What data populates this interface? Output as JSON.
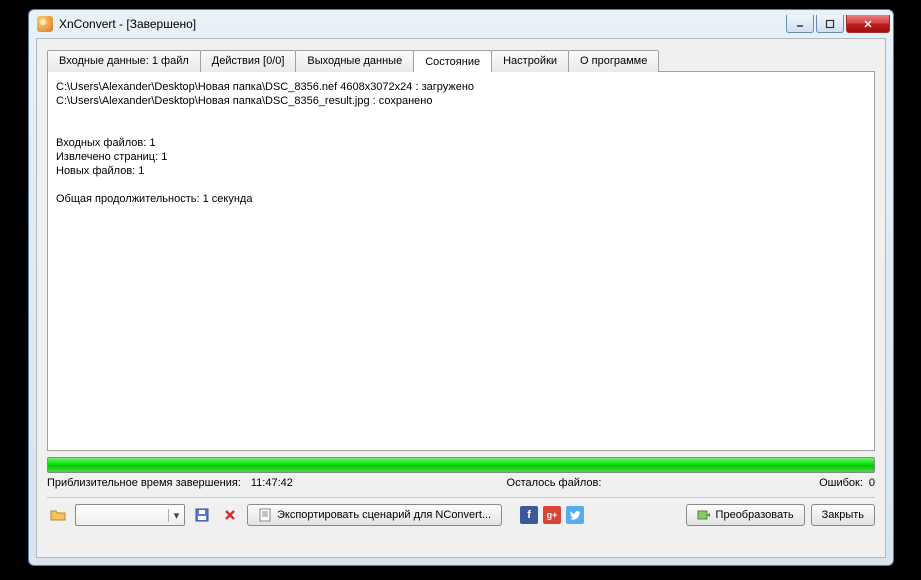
{
  "window": {
    "title": "XnConvert - [Завершено]"
  },
  "tabs": [
    "Входные данные: 1 файл",
    "Действия [0/0]",
    "Выходные данные",
    "Состояние",
    "Настройки",
    "О программе"
  ],
  "activeTab": 3,
  "log": "C:\\Users\\Alexander\\Desktop\\Новая папка\\DSC_8356.nef 4608x3072x24 : загружено\nC:\\Users\\Alexander\\Desktop\\Новая папка\\DSC_8356_result.jpg : сохранено\n\n\nВходных файлов: 1\nИзвлечено страниц: 1\nНовых файлов: 1\n\nОбщая продолжительность: 1 секунда",
  "status": {
    "etaLabel": "Приблизительное время завершения:",
    "etaValue": "11:47:42",
    "remainingLabel": "Осталось файлов:",
    "remainingValue": "",
    "errorsLabel": "Ошибок:",
    "errorsValue": "0"
  },
  "buttons": {
    "export": "Экспортировать сценарий для NConvert...",
    "convert": "Преобразовать",
    "close": "Закрыть"
  }
}
